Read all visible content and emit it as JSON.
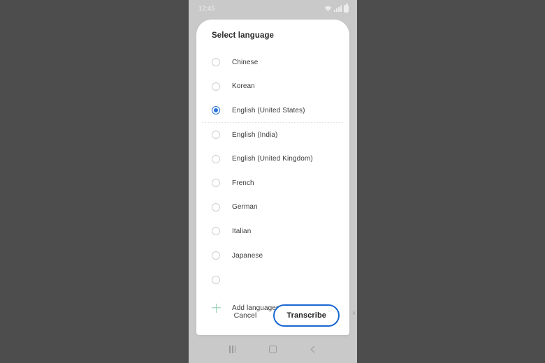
{
  "status_bar": {
    "time": "12:45",
    "icons": [
      "wifi-icon",
      "signal-icon",
      "battery-icon"
    ]
  },
  "dialog": {
    "title": "Select language",
    "languages": [
      {
        "label": "Chinese",
        "selected": false,
        "divider": false
      },
      {
        "label": "Korean",
        "selected": false,
        "divider": false
      },
      {
        "label": "English (United States)",
        "selected": true,
        "divider": true
      },
      {
        "label": "English (India)",
        "selected": false,
        "divider": false
      },
      {
        "label": "English (United Kingdom)",
        "selected": false,
        "divider": false
      },
      {
        "label": "French",
        "selected": false,
        "divider": false
      },
      {
        "label": "German",
        "selected": false,
        "divider": false
      },
      {
        "label": "Italian",
        "selected": false,
        "divider": false
      },
      {
        "label": "Japanese",
        "selected": false,
        "divider": false
      },
      {
        "label": "",
        "selected": false,
        "divider": false
      }
    ],
    "add_languages": {
      "label": "Add languages",
      "icon": "plus-icon"
    },
    "actions": {
      "cancel_label": "Cancel",
      "confirm_label": "Transcribe"
    }
  },
  "nav_bar": {
    "recents_label": "recents-icon",
    "home_label": "home-icon",
    "back_label": "back-icon"
  },
  "colors": {
    "accent_blue": "#1967d2",
    "radio_selected": "#2a73d6",
    "plus_green": "#86c9ab",
    "page_background": "#4d4d4d",
    "phone_frame": "#c8c8c8"
  }
}
